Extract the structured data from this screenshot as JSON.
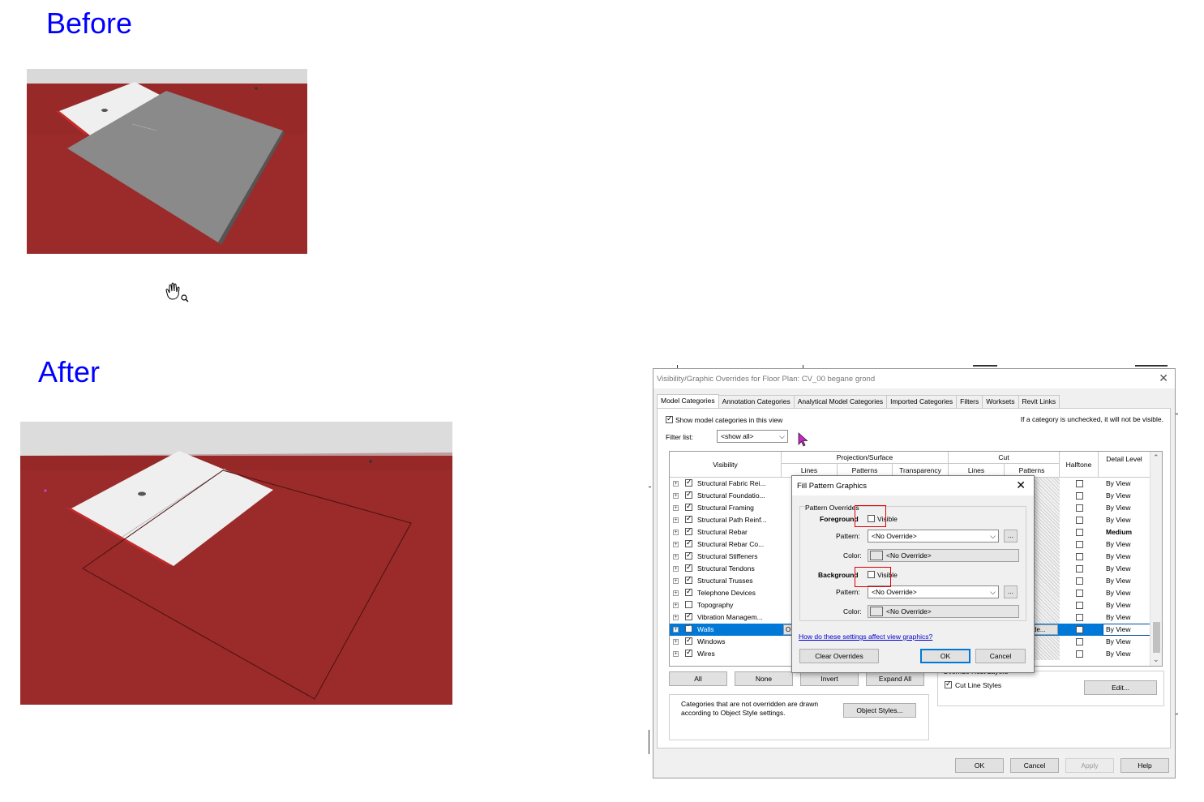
{
  "labels": {
    "before": "Before",
    "after": "After"
  },
  "dialog": {
    "title": "Visibility/Graphic Overrides for Floor Plan: CV_00 begane grond",
    "tabs": [
      "Model Categories",
      "Annotation Categories",
      "Analytical Model Categories",
      "Imported Categories",
      "Filters",
      "Worksets",
      "Revit Links"
    ],
    "show_model_categories": "Show model categories in this view",
    "unchecked_note": "If a category is unchecked, it will not be visible.",
    "filter_list_label": "Filter list:",
    "filter_list_value": "<show all>",
    "headers": {
      "visibility": "Visibility",
      "projection_surface": "Projection/Surface",
      "cut": "Cut",
      "lines": "Lines",
      "patterns": "Patterns",
      "transparency": "Transparency",
      "cut_lines": "Lines",
      "cut_patterns": "Patterns",
      "halftone": "Halftone",
      "detail_level": "Detail Level"
    },
    "rows": [
      {
        "name": "Structural Fabric Rei...",
        "checked": true,
        "detail": "By View",
        "bold": false
      },
      {
        "name": "Structural Foundatio...",
        "checked": true,
        "detail": "By View",
        "bold": false
      },
      {
        "name": "Structural Framing",
        "checked": true,
        "detail": "By View",
        "bold": false
      },
      {
        "name": "Structural Path Reinf...",
        "checked": true,
        "detail": "By View",
        "bold": false
      },
      {
        "name": "Structural Rebar",
        "checked": true,
        "detail": "Medium",
        "bold": true
      },
      {
        "name": "Structural Rebar Co...",
        "checked": true,
        "detail": "By View",
        "bold": false
      },
      {
        "name": "Structural Stiffeners",
        "checked": true,
        "detail": "By View",
        "bold": false
      },
      {
        "name": "Structural Tendons",
        "checked": true,
        "detail": "By View",
        "bold": false
      },
      {
        "name": "Structural Trusses",
        "checked": true,
        "detail": "By View",
        "bold": false
      },
      {
        "name": "Telephone Devices",
        "checked": true,
        "detail": "By View",
        "bold": false
      },
      {
        "name": "Topography",
        "checked": false,
        "detail": "By View",
        "bold": false
      },
      {
        "name": "Vibration Managem...",
        "checked": true,
        "detail": "By View",
        "bold": false
      },
      {
        "name": "Walls",
        "checked": true,
        "detail": "By View",
        "bold": false,
        "selected": true
      },
      {
        "name": "Windows",
        "checked": true,
        "detail": "By View",
        "bold": false
      },
      {
        "name": "Wires",
        "checked": true,
        "detail": "By View",
        "bold": false
      }
    ],
    "walls_cell_left": "O",
    "walls_cell_right": "de...",
    "buttons": {
      "all": "All",
      "none": "None",
      "invert": "Invert",
      "expand_all": "Expand All",
      "object_styles": "Object Styles...",
      "edit": "Edit...",
      "ok": "OK",
      "cancel": "Cancel",
      "apply": "Apply",
      "help": "Help"
    },
    "override_host_layers": "Override Host Layers",
    "cut_line_styles": "Cut Line Styles",
    "not_overridden_note": "Categories that are not overridden are drawn according to Object Style settings."
  },
  "fill_dialog": {
    "title": "Fill Pattern Graphics",
    "group": "Pattern Overrides",
    "foreground": "Foreground",
    "background": "Background",
    "visible": "Visible",
    "pattern_label": "Pattern:",
    "color_label": "Color:",
    "no_override": "<No Override>",
    "dots": "...",
    "link": "How do these settings affect view graphics?",
    "clear_overrides": "Clear Overrides",
    "ok": "OK",
    "cancel": "Cancel"
  },
  "colors": {
    "floor_red": "#9b2b2b",
    "heading_blue": "#0000ff",
    "slab_grey": "#8a8a8a",
    "selection_blue": "#0078d7"
  }
}
